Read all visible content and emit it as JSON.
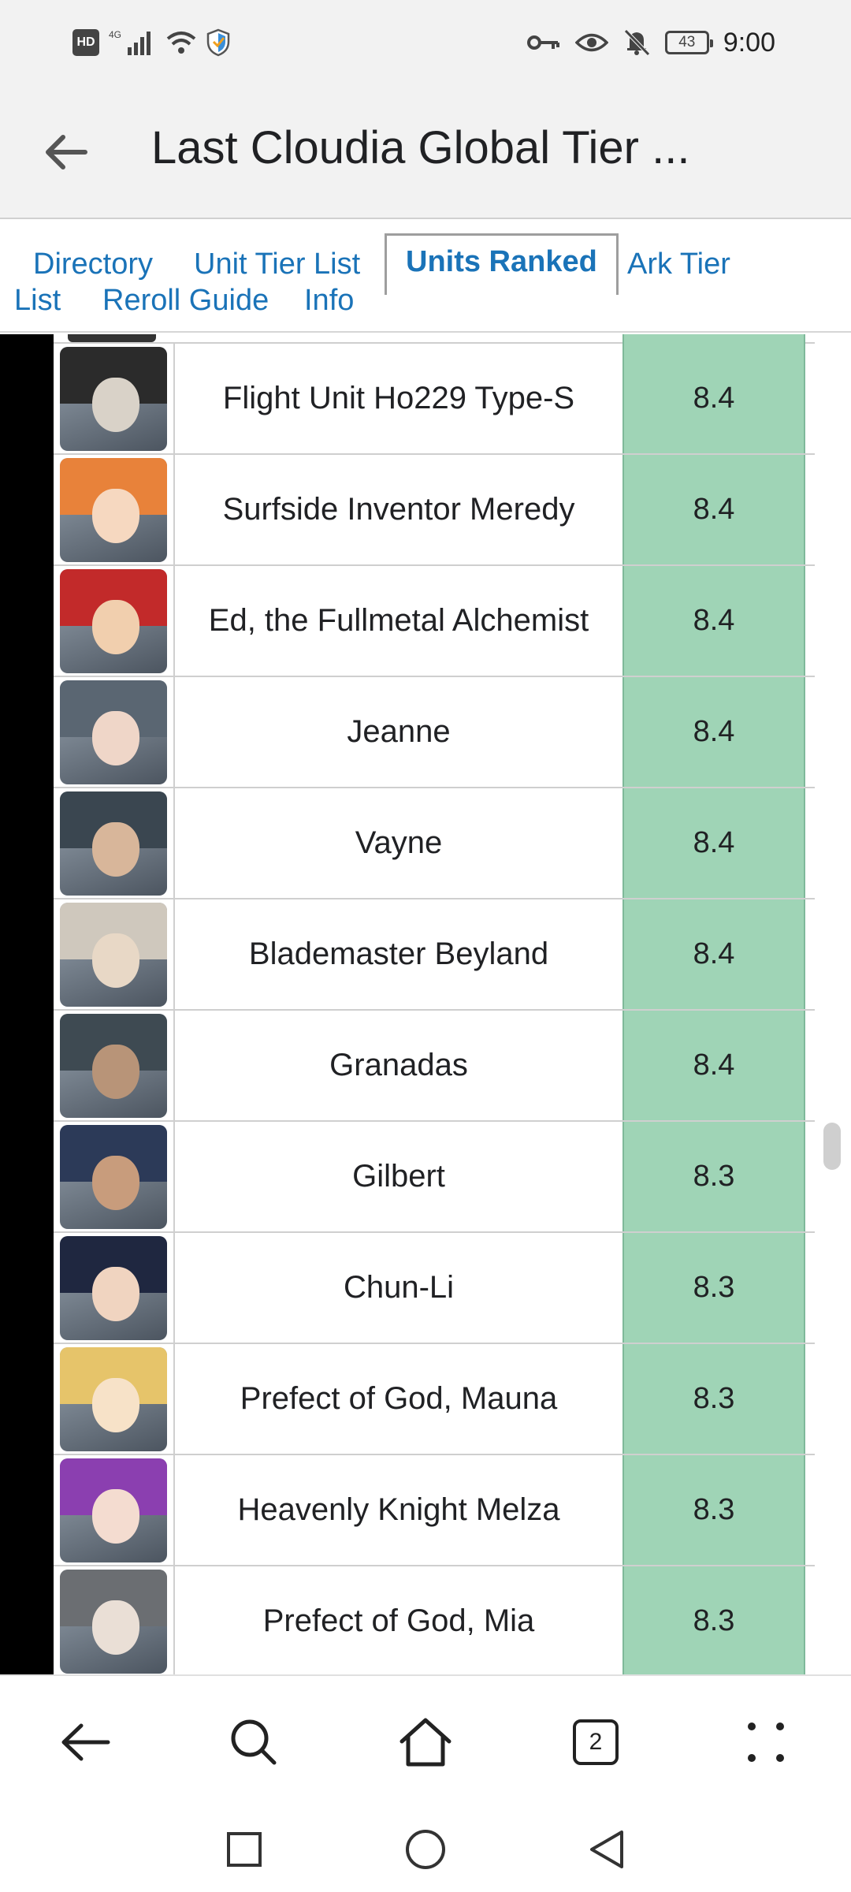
{
  "status_bar": {
    "time": "9:00",
    "battery": "43",
    "hd": "HD",
    "network": "4G"
  },
  "app_bar": {
    "title": "Last Cloudia Global Tier ..."
  },
  "tabs": [
    {
      "label": "Directory"
    },
    {
      "label": "Unit Tier List"
    },
    {
      "label": "Units Ranked",
      "active": true
    },
    {
      "label": "Ark Tier"
    },
    {
      "label": "List"
    },
    {
      "label": "Reroll Guide"
    },
    {
      "label": "Info"
    }
  ],
  "units": [
    {
      "name": "Flight Unit Ho229 Type-S",
      "score": "8.4"
    },
    {
      "name": "Surfside Inventor Meredy",
      "score": "8.4"
    },
    {
      "name": "Ed, the Fullmetal Alchemist",
      "score": "8.4"
    },
    {
      "name": "Jeanne",
      "score": "8.4"
    },
    {
      "name": "Vayne",
      "score": "8.4"
    },
    {
      "name": "Blademaster Beyland",
      "score": "8.4"
    },
    {
      "name": "Granadas",
      "score": "8.4"
    },
    {
      "name": "Gilbert",
      "score": "8.3"
    },
    {
      "name": "Chun-Li",
      "score": "8.3"
    },
    {
      "name": "Prefect of God, Mauna",
      "score": "8.3"
    },
    {
      "name": "Heavenly Knight Melza",
      "score": "8.3"
    },
    {
      "name": "Prefect of God, Mia",
      "score": "8.3"
    }
  ],
  "colors": {
    "link": "#1a73b8",
    "score_bg": "#9fd4b6",
    "band": "#000000"
  },
  "toolbar": {
    "tab_count": "2"
  },
  "icons": [
    "back-arrow-icon",
    "search-icon",
    "home-icon",
    "tab-switcher-icon",
    "more-icon",
    "recents-icon",
    "home-circle-icon",
    "back-triangle-icon"
  ]
}
